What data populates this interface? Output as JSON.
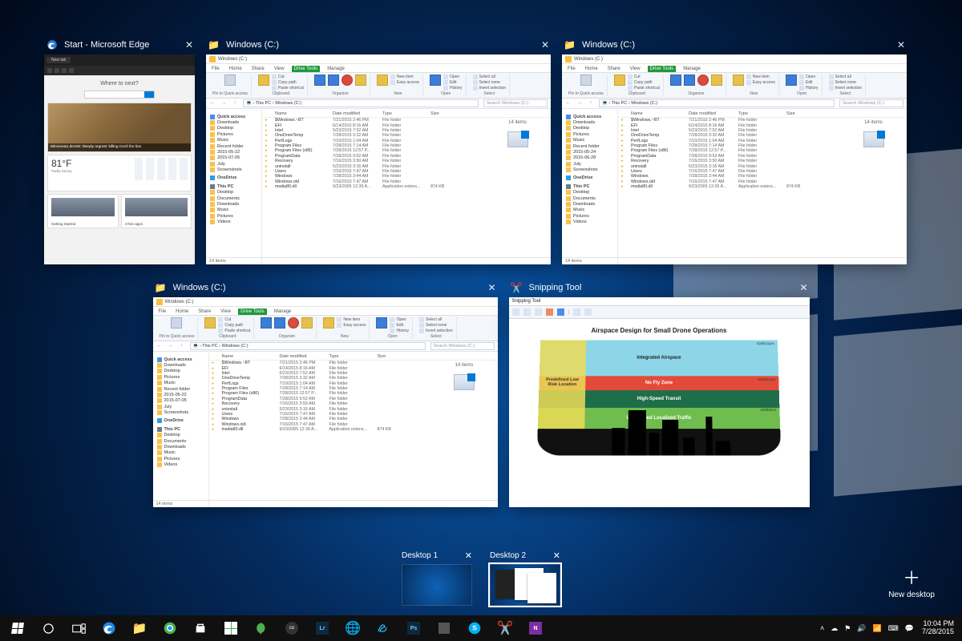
{
  "windows": [
    {
      "id": "edge",
      "title": "Start - Microsoft Edge",
      "app": "edge"
    },
    {
      "id": "exp1",
      "title": "Windows (C:)",
      "app": "explorer"
    },
    {
      "id": "exp2",
      "title": "Windows (C:)",
      "app": "explorer"
    },
    {
      "id": "exp3",
      "title": "Windows (C:)",
      "app": "explorer"
    },
    {
      "id": "snip",
      "title": "Snipping Tool",
      "app": "snip"
    }
  ],
  "edge": {
    "tab": "New tab",
    "heading": "Where to next?",
    "search_placeholder": "Search or enter web address",
    "hero_caption": "Minnesota dentist 'deeply regrets' killing Cecil the lion",
    "weather_temp": "81°F",
    "weather_desc": "Partly Sunny",
    "card_labels": [
      "Getting Started",
      "4 free apps"
    ]
  },
  "explorer": {
    "title": "Windows (C:)",
    "ribbon_tabs": [
      "File",
      "Home",
      "Share",
      "View",
      "Drive Tools",
      "Manage"
    ],
    "ribbon_groups": {
      "pin": "Pin to Quick access",
      "clipboard": "Clipboard",
      "copy": "Copy",
      "paste": "Paste",
      "cut": "Cut",
      "copy_path": "Copy path",
      "paste_sc": "Paste shortcut",
      "organize": "Organize",
      "move": "Move to",
      "copy_to": "Copy to",
      "delete": "Delete",
      "rename": "Rename",
      "new": "New",
      "new_folder": "New folder",
      "new_item": "New item",
      "easy_access": "Easy access",
      "open": "Open",
      "properties": "Properties",
      "edit": "Edit",
      "history": "History",
      "select": "Select",
      "select_all": "Select all",
      "select_none": "Select none",
      "invert": "Invert selection"
    },
    "path": [
      "This PC",
      "Windows (C:)"
    ],
    "search_placeholder": "Search Windows (C:)",
    "columns": [
      "",
      "Name",
      "Date modified",
      "Type",
      "Size"
    ],
    "items": [
      {
        "name": "$Windows.~BT",
        "date": "7/21/2015 2:46 PM",
        "type": "File folder",
        "size": ""
      },
      {
        "name": "EFI",
        "date": "6/14/2015 8:16 AM",
        "type": "File folder",
        "size": ""
      },
      {
        "name": "Intel",
        "date": "5/23/2015 7:52 AM",
        "type": "File folder",
        "size": ""
      },
      {
        "name": "OneDriveTemp",
        "date": "7/28/2015 3:32 AM",
        "type": "File folder",
        "size": ""
      },
      {
        "name": "PerfLogs",
        "date": "7/10/2015 1:04 AM",
        "type": "File folder",
        "size": ""
      },
      {
        "name": "Program Files",
        "date": "7/28/2015 7:14 AM",
        "type": "File folder",
        "size": ""
      },
      {
        "name": "Program Files (x86)",
        "date": "7/28/2015 12:57 P...",
        "type": "File folder",
        "size": ""
      },
      {
        "name": "ProgramData",
        "date": "7/28/2015 9:52 AM",
        "type": "File folder",
        "size": ""
      },
      {
        "name": "Recovery",
        "date": "7/16/2015 3:50 AM",
        "type": "File folder",
        "size": ""
      },
      {
        "name": "uninstall",
        "date": "5/23/2015 3:16 AM",
        "type": "File folder",
        "size": ""
      },
      {
        "name": "Users",
        "date": "7/16/2015 7:47 AM",
        "type": "File folder",
        "size": ""
      },
      {
        "name": "Windows",
        "date": "7/28/2015 3:44 AM",
        "type": "File folder",
        "size": ""
      },
      {
        "name": "Windows.old",
        "date": "7/16/2015 7:47 AM",
        "type": "File folder",
        "size": ""
      },
      {
        "name": "msdia80.dll",
        "date": "9/23/2005 12:39 A...",
        "type": "Application extens...",
        "size": "874 KB"
      }
    ],
    "nav": {
      "quick_access": "Quick access",
      "quick_items": [
        "Downloads",
        "Desktop",
        "Pictures",
        "Music",
        "Recent folder",
        "2015-05-22",
        "2015-07-05",
        "July",
        "Screenshots"
      ],
      "quick_items_alt": [
        "Downloads",
        "Desktop",
        "Pictures",
        "Music",
        "Recent folder",
        "2015-05-24",
        "2015-06-28",
        "July",
        "Screenshots"
      ],
      "onedrive": "OneDrive",
      "this_pc": "This PC",
      "pc_items": [
        "Desktop",
        "Documents",
        "Downloads",
        "Music",
        "Pictures",
        "Videos"
      ]
    },
    "item_count": "14 items",
    "status": "14 items"
  },
  "snip": {
    "title": "Snipping Tool",
    "tool_buttons": [
      "New",
      "Mode",
      "Delay",
      "Cancel",
      "Options"
    ],
    "chart_title": "Airspace Design for Small Drone Operations",
    "bands": {
      "blue": "Integrated Airspace",
      "red": "No Fly Zone",
      "dark_green": "High-Speed Transit",
      "light_green": "Low-Speed Localized Traffic",
      "yellow": "Predefined Low Risk Location"
    },
    "altitudes": [
      "500ft/152m",
      "400ft/122m",
      "200ft/61m"
    ]
  },
  "virtual_desktops": {
    "items": [
      {
        "label": "Desktop 1",
        "active": false
      },
      {
        "label": "Desktop 2",
        "active": true
      }
    ],
    "new_desktop": "New desktop"
  },
  "taskbar": {
    "system_tray_icons": [
      "up",
      "cloud",
      "shield",
      "speaker",
      "wifi",
      "battery",
      "keyboard",
      "notifications"
    ],
    "time": "10:04 PM",
    "date": "7/28/2015"
  }
}
